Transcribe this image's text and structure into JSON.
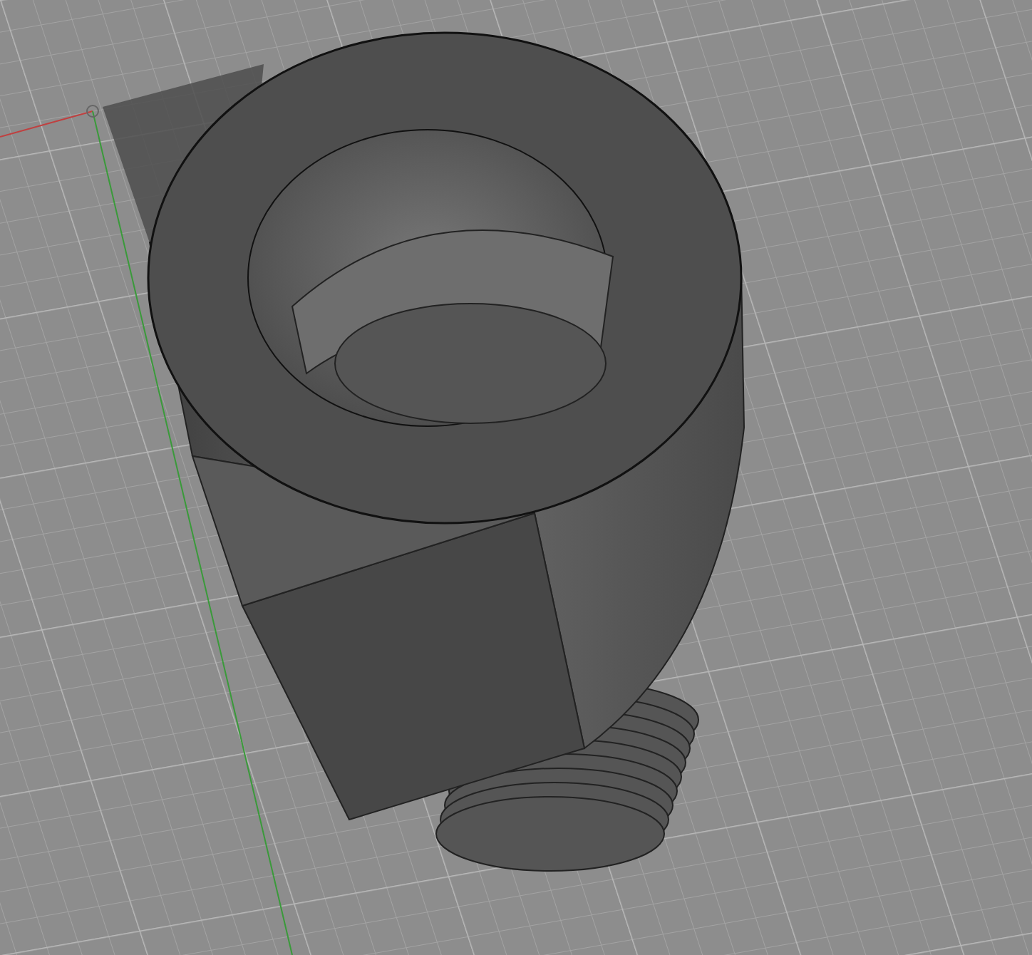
{
  "viewport": {
    "axes": true,
    "grid": true
  }
}
